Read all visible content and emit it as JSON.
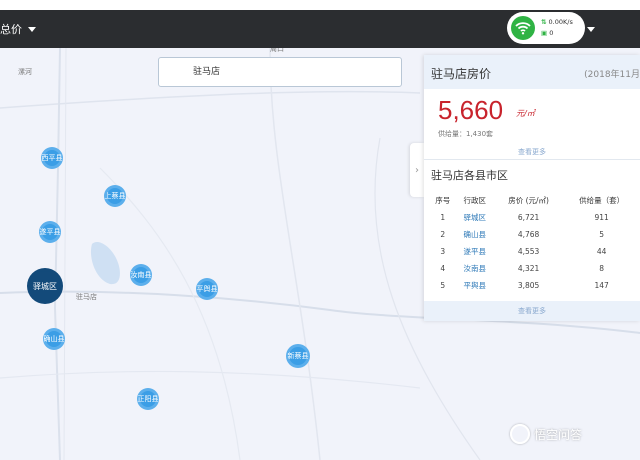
{
  "topbar": {
    "menu_label": "总价",
    "network": {
      "speed": "0.00K/s",
      "count": "0"
    }
  },
  "colors": {
    "bubble": "#3b9ee6",
    "bubble_selected": "#134a7a",
    "price_red": "#c8232c",
    "link_blue": "#2f7ab8",
    "wifi_green": "#2fb344"
  },
  "map": {
    "search": {
      "value": "驻马店"
    },
    "labels": {
      "top_road": "周口",
      "left_place": "漯河",
      "city": "驻马店"
    },
    "bubbles": [
      {
        "label": "西平县",
        "selected": false
      },
      {
        "label": "上蔡县",
        "selected": false
      },
      {
        "label": "遂平县",
        "selected": false
      },
      {
        "label": "驿城区",
        "selected": true
      },
      {
        "label": "汝南县",
        "selected": false
      },
      {
        "label": "平舆县",
        "selected": false
      },
      {
        "label": "确山县",
        "selected": false
      },
      {
        "label": "新蔡县",
        "selected": false
      },
      {
        "label": "正阳县",
        "selected": false
      }
    ]
  },
  "panel": {
    "title": "驻马店房价",
    "date": "(2018年11月",
    "price": "5,660",
    "price_unit": "元/㎡",
    "supply": "供给量：1,430套",
    "more_label": "查看更多",
    "sub_title": "驻马店各县市区",
    "table": {
      "headers": [
        "序号",
        "行政区",
        "房价 (元/㎡)",
        "供给量（套）"
      ],
      "rows": [
        [
          "1",
          "驿城区",
          "6,721",
          "911"
        ],
        [
          "2",
          "确山县",
          "4,768",
          "5"
        ],
        [
          "3",
          "遂平县",
          "4,553",
          "44"
        ],
        [
          "4",
          "汝南县",
          "4,321",
          "8"
        ],
        [
          "5",
          "平舆县",
          "3,805",
          "147"
        ]
      ]
    }
  },
  "watermark": {
    "text": "悟空问答"
  }
}
